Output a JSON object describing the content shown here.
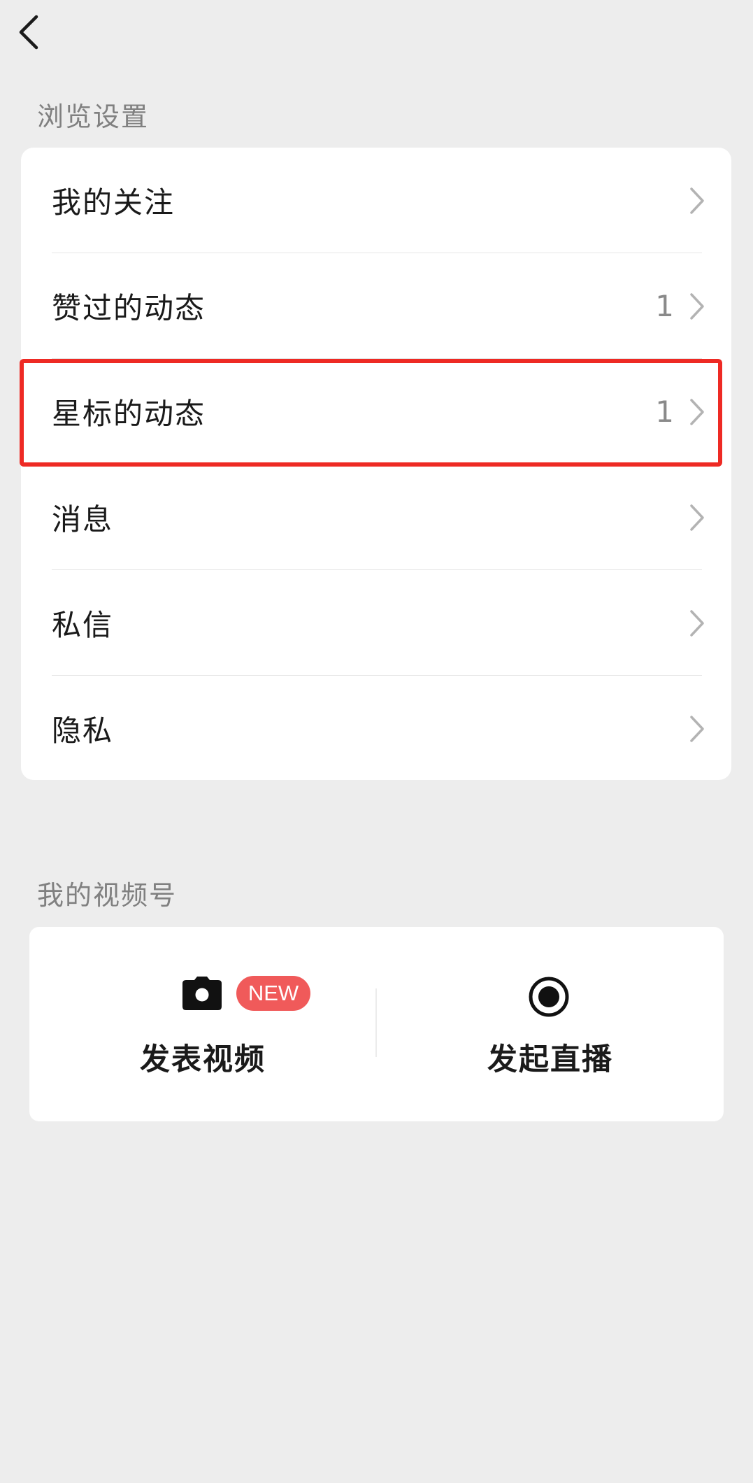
{
  "header": {
    "back_icon": "chevron-left-icon"
  },
  "sections": {
    "browse_title": "浏览设置",
    "channels_title": "我的视频号"
  },
  "settings": {
    "rows": [
      {
        "label": "我的关注",
        "count": ""
      },
      {
        "label": "赞过的动态",
        "count": "1"
      },
      {
        "label": "星标的动态",
        "count": "1"
      },
      {
        "label": "消息",
        "count": ""
      },
      {
        "label": "私信",
        "count": ""
      },
      {
        "label": "隐私",
        "count": ""
      }
    ],
    "highlight_color": "#ee2a24"
  },
  "channels": {
    "post_video_label": "发表视频",
    "post_video_icon": "camera-icon",
    "new_badge": "NEW",
    "new_badge_color": "#f05a5a",
    "live_label": "发起直播",
    "live_icon": "record-icon"
  },
  "colors": {
    "background": "#ededed",
    "card": "#ffffff",
    "secondary_text": "#808080"
  }
}
